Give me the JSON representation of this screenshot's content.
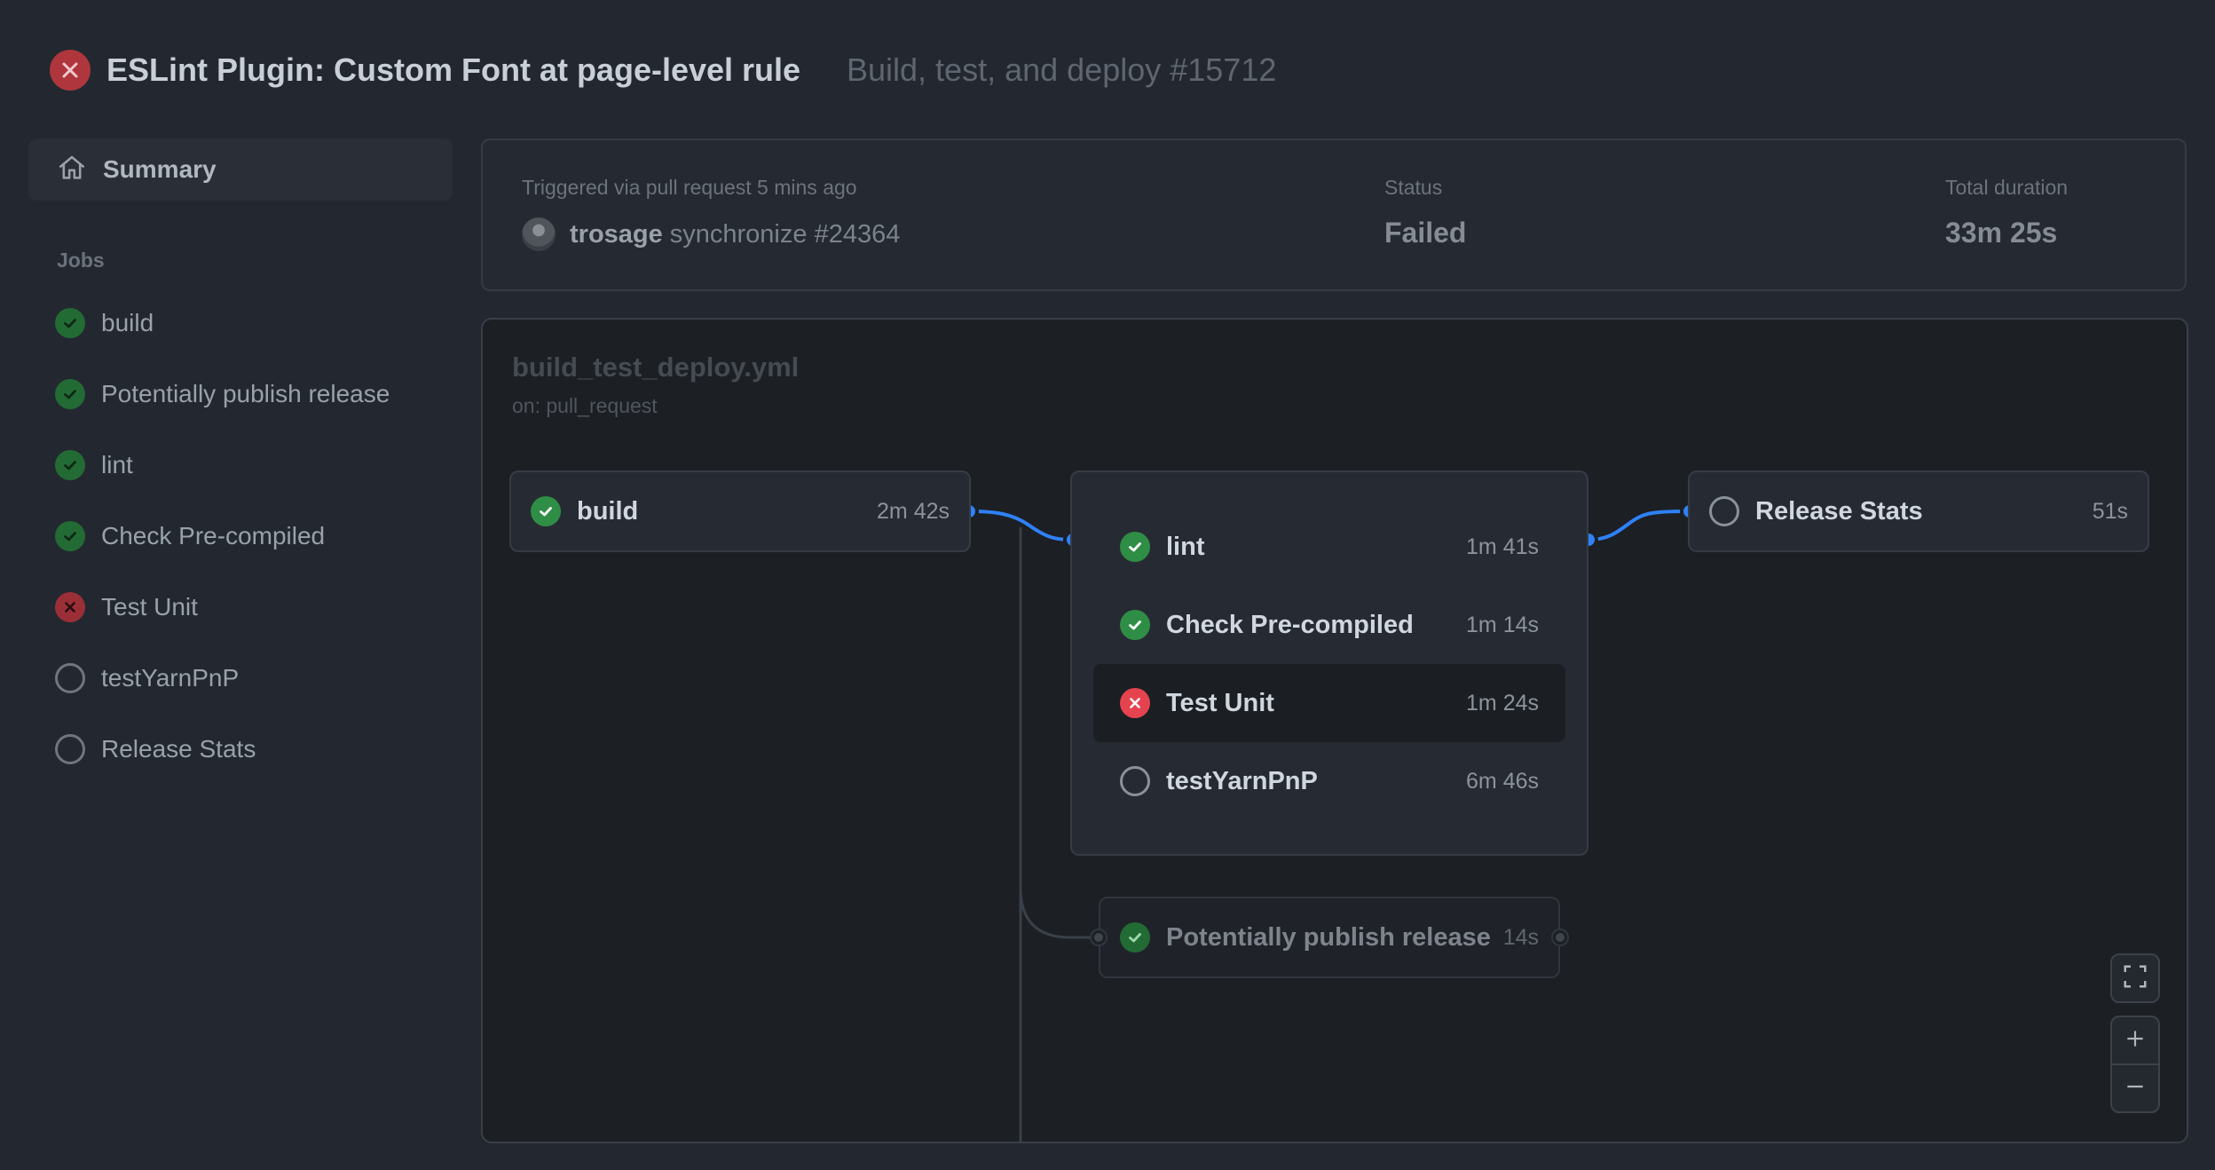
{
  "header": {
    "title": "ESLint Plugin: Custom Font at page-level rule",
    "subtitle": "Build, test, and deploy #15712",
    "status": "failed"
  },
  "sidebar": {
    "summary_label": "Summary",
    "jobs_label": "Jobs",
    "items": [
      {
        "label": "build",
        "status": "success"
      },
      {
        "label": "Potentially publish release",
        "status": "success"
      },
      {
        "label": "lint",
        "status": "success"
      },
      {
        "label": "Check Pre-compiled",
        "status": "success"
      },
      {
        "label": "Test Unit",
        "status": "failure"
      },
      {
        "label": "testYarnPnP",
        "status": "pending"
      },
      {
        "label": "Release Stats",
        "status": "pending"
      }
    ]
  },
  "info": {
    "trigger_label": "Triggered via pull request 5 mins ago",
    "actor": "trosage",
    "event": "synchronize #24364",
    "status_label": "Status",
    "status_value": "Failed",
    "duration_label": "Total duration",
    "duration_value": "33m 25s"
  },
  "graph": {
    "workflow_file": "build_test_deploy.yml",
    "workflow_trigger": "on: pull_request",
    "build": {
      "name": "build",
      "duration": "2m 42s",
      "status": "success"
    },
    "group": [
      {
        "name": "lint",
        "duration": "1m 41s",
        "status": "success"
      },
      {
        "name": "Check Pre-compiled",
        "duration": "1m 14s",
        "status": "success"
      },
      {
        "name": "Test Unit",
        "duration": "1m 24s",
        "status": "failure"
      },
      {
        "name": "testYarnPnP",
        "duration": "6m 46s",
        "status": "pending"
      }
    ],
    "release_stats": {
      "name": "Release Stats",
      "duration": "51s",
      "status": "pending"
    },
    "publish": {
      "name": "Potentially publish release",
      "duration": "14s",
      "status": "success"
    }
  },
  "colors": {
    "success": "#2f8e45",
    "failure": "#e5434f",
    "connector_active": "#2f81f7",
    "connector_inactive": "#3a4048"
  }
}
